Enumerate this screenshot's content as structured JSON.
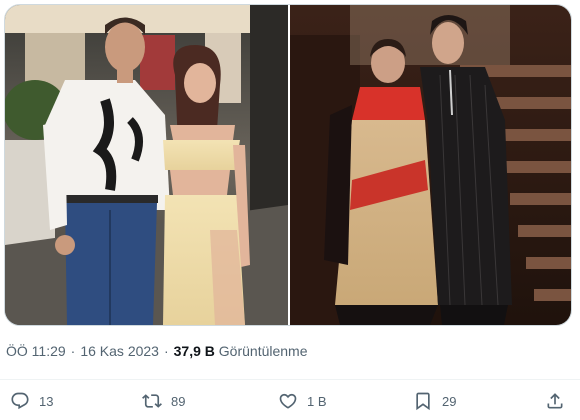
{
  "media": {
    "photos": [
      {
        "alt": ""
      },
      {
        "alt": ""
      }
    ]
  },
  "meta": {
    "time": "ÖÖ 11:29",
    "separator": "·",
    "date": "16 Kas 2023",
    "views_count": "37,9 B",
    "views_label": "Görüntülenme"
  },
  "actions": {
    "reply_count": "13",
    "retweet_count": "89",
    "like_count": "1 B",
    "bookmark_count": "29"
  },
  "icons": {
    "reply": "reply-icon",
    "retweet": "retweet-icon",
    "like": "heart-icon",
    "bookmark": "bookmark-icon",
    "share": "share-icon"
  },
  "colors": {
    "secondary_text": "#536471",
    "primary_text": "#0f1419",
    "border": "#cfd9de"
  }
}
